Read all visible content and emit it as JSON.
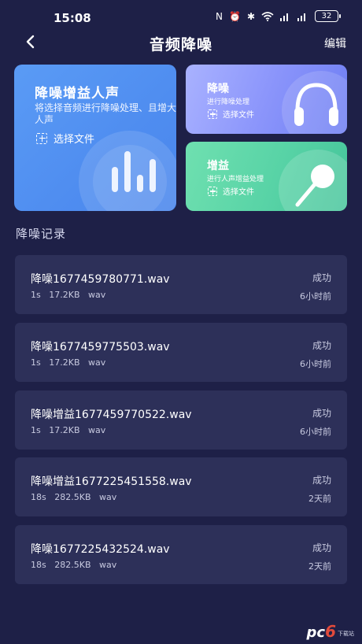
{
  "status_bar": {
    "time": "15:08",
    "indicators": [
      "N",
      "⏰",
      "✱",
      "wifi",
      "4G",
      "4G"
    ],
    "battery": "32"
  },
  "nav": {
    "title": "音频降噪",
    "edit_label": "编辑"
  },
  "cards": {
    "denoise_boost": {
      "title": "降噪增益人声",
      "desc": "将选择音频进行降噪处理、且增大人声",
      "pick_label": "选择文件"
    },
    "denoise": {
      "title": "降噪",
      "desc": "进行降噪处理",
      "pick_label": "选择文件"
    },
    "boost": {
      "title": "增益",
      "desc": "进行人声增益处理",
      "pick_label": "选择文件"
    }
  },
  "records_section": {
    "title": "降噪记录",
    "items": [
      {
        "name": "降噪1677459780771.wav",
        "duration": "1s",
        "size": "17.2KB",
        "format": "wav",
        "status": "成功",
        "time": "6小时前"
      },
      {
        "name": "降噪1677459775503.wav",
        "duration": "1s",
        "size": "17.2KB",
        "format": "wav",
        "status": "成功",
        "time": "6小时前"
      },
      {
        "name": "降噪增益1677459770522.wav",
        "duration": "1s",
        "size": "17.2KB",
        "format": "wav",
        "status": "成功",
        "time": "6小时前"
      },
      {
        "name": "降噪增益1677225451558.wav",
        "duration": "18s",
        "size": "282.5KB",
        "format": "wav",
        "status": "成功",
        "time": "2天前"
      },
      {
        "name": "降噪1677225432524.wav",
        "duration": "18s",
        "size": "282.5KB",
        "format": "wav",
        "status": "成功",
        "time": "2天前"
      }
    ]
  },
  "watermark": {
    "main": "pc",
    "digit": "6",
    "sub": "下载站"
  },
  "colors": {
    "background": "#1e2047",
    "record_bg": "#2d3059",
    "card_blue": "#4f8df0",
    "card_purple": "#8b95fb",
    "card_green": "#58d3a6"
  }
}
